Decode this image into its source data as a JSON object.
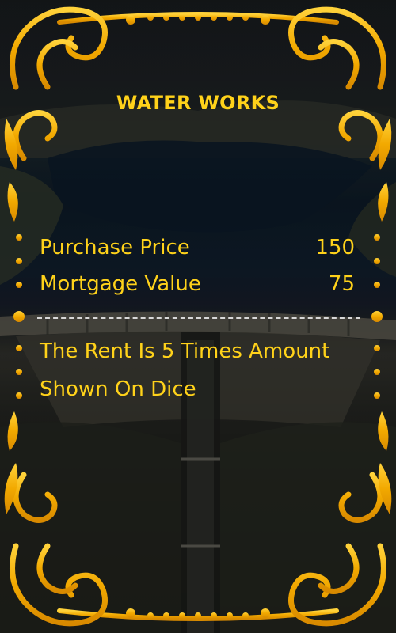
{
  "card": {
    "title": "WATER WORKS",
    "rows": [
      {
        "label": "Purchase Price",
        "value": "150"
      },
      {
        "label": "Mortgage Value",
        "value": "75"
      }
    ],
    "rent_text": "The Rent Is 5 Times Amount Shown On Dice"
  },
  "colors": {
    "text": "#ffd21a",
    "frame_gold": "#f4b000",
    "divider": "#d8d8d8"
  },
  "icons": {
    "frame": "ornate-gold-scroll-frame-icon"
  }
}
